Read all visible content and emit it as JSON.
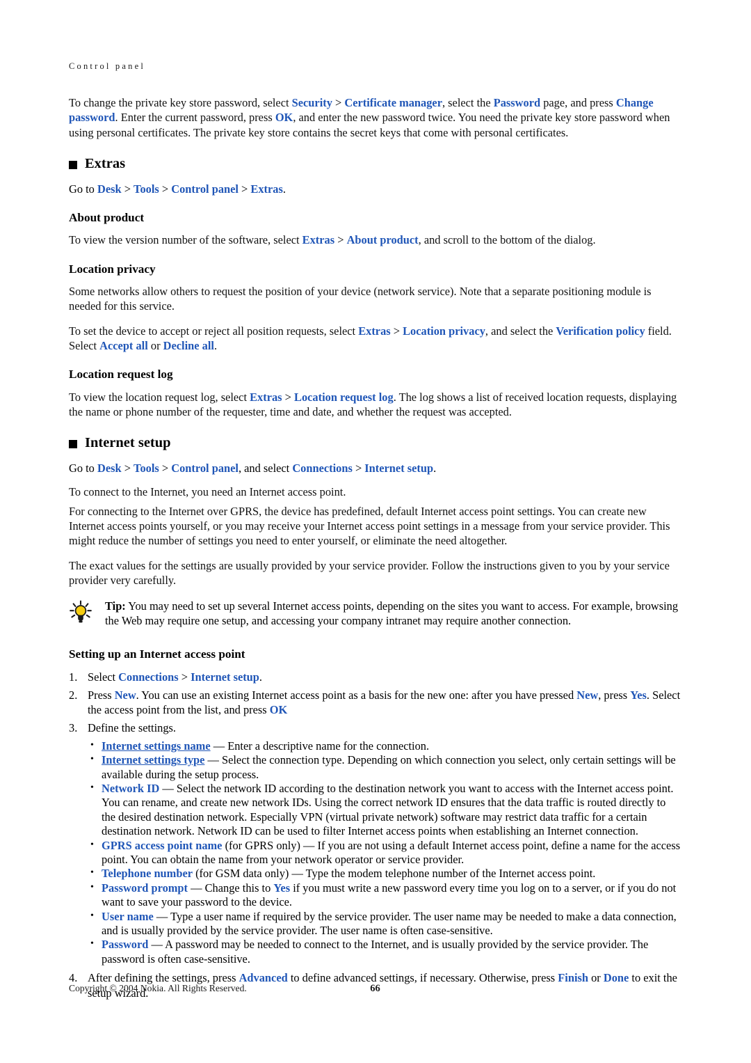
{
  "page": {
    "running_header": "Control panel",
    "number": "66",
    "copyright": "Copyright © 2004 Nokia. All Rights Reserved."
  },
  "intro": {
    "p1_a": "To change the private key store password, select ",
    "link_security": "Security",
    "sep": ">",
    "link_cert_manager": "Certificate manager",
    "p1_b": ", select the ",
    "link_password": "Password",
    "p1_c": " page, and press ",
    "link_change_password": "Change password",
    "p1_d": ". Enter the current password, press ",
    "link_ok": "OK",
    "p1_e": ", and enter the new password twice. You need the private key store password when using personal certificates. The private key store contains the secret keys that come with personal certificates."
  },
  "extras": {
    "heading": "Extras",
    "goto_prefix": "Go to ",
    "goto_desk": "Desk",
    "goto_tools": "Tools",
    "goto_control_panel": "Control panel",
    "goto_extras": "Extras",
    "goto_suffix": ".",
    "about_product": {
      "heading": "About product",
      "text_a": "To view the version number of the software, select ",
      "link_extras": "Extras",
      "link_about_product": "About product",
      "text_b": ", and scroll to the bottom of the dialog."
    },
    "location_privacy": {
      "heading": "Location privacy",
      "para1": "Some networks allow others to request the position of your device (network service). Note that a separate positioning module is needed for this service.",
      "para2_a": "To set the device to accept or reject all position requests, select ",
      "link_extras": "Extras",
      "link_location_privacy": "Location privacy",
      "para2_b": ", and select the ",
      "link_verification_policy": "Verification policy",
      "para2_c": " field. Select ",
      "link_accept_all": "Accept all",
      "para2_d": " or ",
      "link_decline_all": "Decline all",
      "para2_e": "."
    },
    "location_request_log": {
      "heading": "Location request log",
      "text_a": "To view the location request log, select ",
      "link_extras": "Extras",
      "link_location_request_log": "Location request log",
      "text_b": ". The log shows a list of received location requests, displaying the name or phone number of the requester, time and date, and whether the request was accepted."
    }
  },
  "internet_setup": {
    "heading": "Internet setup",
    "goto_prefix": "Go to ",
    "goto_desk": "Desk",
    "goto_tools": "Tools",
    "goto_control_panel": "Control panel",
    "goto_mid": ", and select ",
    "goto_connections": "Connections",
    "goto_internet_setup": "Internet setup",
    "goto_suffix": ".",
    "para_connect": "To connect to the Internet, you need an Internet access point.",
    "para_gprs": "For connecting to the Internet over GPRS, the device has predefined, default Internet access point settings. You can create new Internet access points yourself, or you may receive your Internet access point settings in a message from your service provider. This might reduce the number of settings you need to enter yourself, or eliminate the need altogether.",
    "para_values": "The exact values for the settings are usually provided by your service provider. Follow the instructions given to you by your service provider very carefully.",
    "tip": {
      "icon": "lightbulb-icon",
      "label": "Tip:",
      "text": " You may need to set up several Internet access points, depending on the sites you want to access. For example, browsing the Web may require one setup, and accessing your company intranet may require another connection."
    },
    "setting_up": {
      "heading": "Setting up an Internet access point",
      "step1": {
        "num": "1.",
        "text_a": "Select ",
        "link_connections": "Connections",
        "sep": ">",
        "link_internet_setup": "Internet setup",
        "text_b": "."
      },
      "step2": {
        "num": "2.",
        "text_a": "Press ",
        "link_new_1": "New",
        "text_b": ". You can use an existing Internet access point as a basis for the new one: after you have pressed ",
        "link_new_2": "New",
        "text_c": ", press ",
        "link_yes": "Yes",
        "text_d": ". Select the access point from the list, and press ",
        "link_ok": "OK"
      },
      "step3": {
        "num": "3.",
        "text": "Define the settings.",
        "terms": [
          {
            "term": "Internet settings name",
            "underline": true,
            "qualifier": "",
            "desc": " — Enter a descriptive name for the connection."
          },
          {
            "term": "Internet settings type",
            "underline": true,
            "qualifier": "",
            "desc": " — Select the connection type. Depending on which connection you select, only certain settings will be available during the setup process."
          },
          {
            "term": "Network ID",
            "underline": false,
            "qualifier": "",
            "desc": " — Select the network ID according to the destination network you want to access with the Internet access point. You can rename, and create new network IDs. Using the correct network ID ensures that the data traffic is routed directly to the desired destination network. Especially VPN (virtual private network) software may restrict data traffic for a certain destination network. Network ID can be used to filter Internet access points when establishing an Internet connection."
          },
          {
            "term": "GPRS access point name",
            "underline": false,
            "qualifier": " (for GPRS only)",
            "desc": " — If you are not using a default Internet access point, define a name for the access point. You can obtain the name from your network operator or service provider."
          },
          {
            "term": "Telephone number",
            "underline": false,
            "qualifier": " (for GSM data only)",
            "desc": " — Type the modem telephone number of the Internet access point."
          },
          {
            "term": "Password prompt",
            "underline": false,
            "qualifier": "",
            "desc": " — Change this to ",
            "inline_link": "Yes",
            "desc2": " if you must write a new password every time you log on to a server, or if you do not want to save your password to the device."
          },
          {
            "term": "User name",
            "underline": false,
            "qualifier": "",
            "desc": " — Type a user name if required by the service provider. The user name may be needed to make a data connection, and is usually provided by the service provider. The user name is often case-sensitive."
          },
          {
            "term": "Password",
            "underline": false,
            "qualifier": "",
            "desc": " — A password may be needed to connect to the Internet, and is usually provided by the service provider. The password is often case-sensitive."
          }
        ]
      },
      "step4": {
        "num": "4.",
        "text_a": "After defining the settings, press ",
        "link_advanced": "Advanced",
        "text_b": " to define advanced settings, if necessary. Otherwise, press ",
        "link_finish": "Finish",
        "text_c": " or ",
        "link_done": "Done",
        "text_d": " to exit the setup wizard."
      }
    }
  },
  "colors": {
    "link_blue": "#2056b7",
    "text_black": "#111111",
    "tip_bulb": "#f5cc0f"
  }
}
